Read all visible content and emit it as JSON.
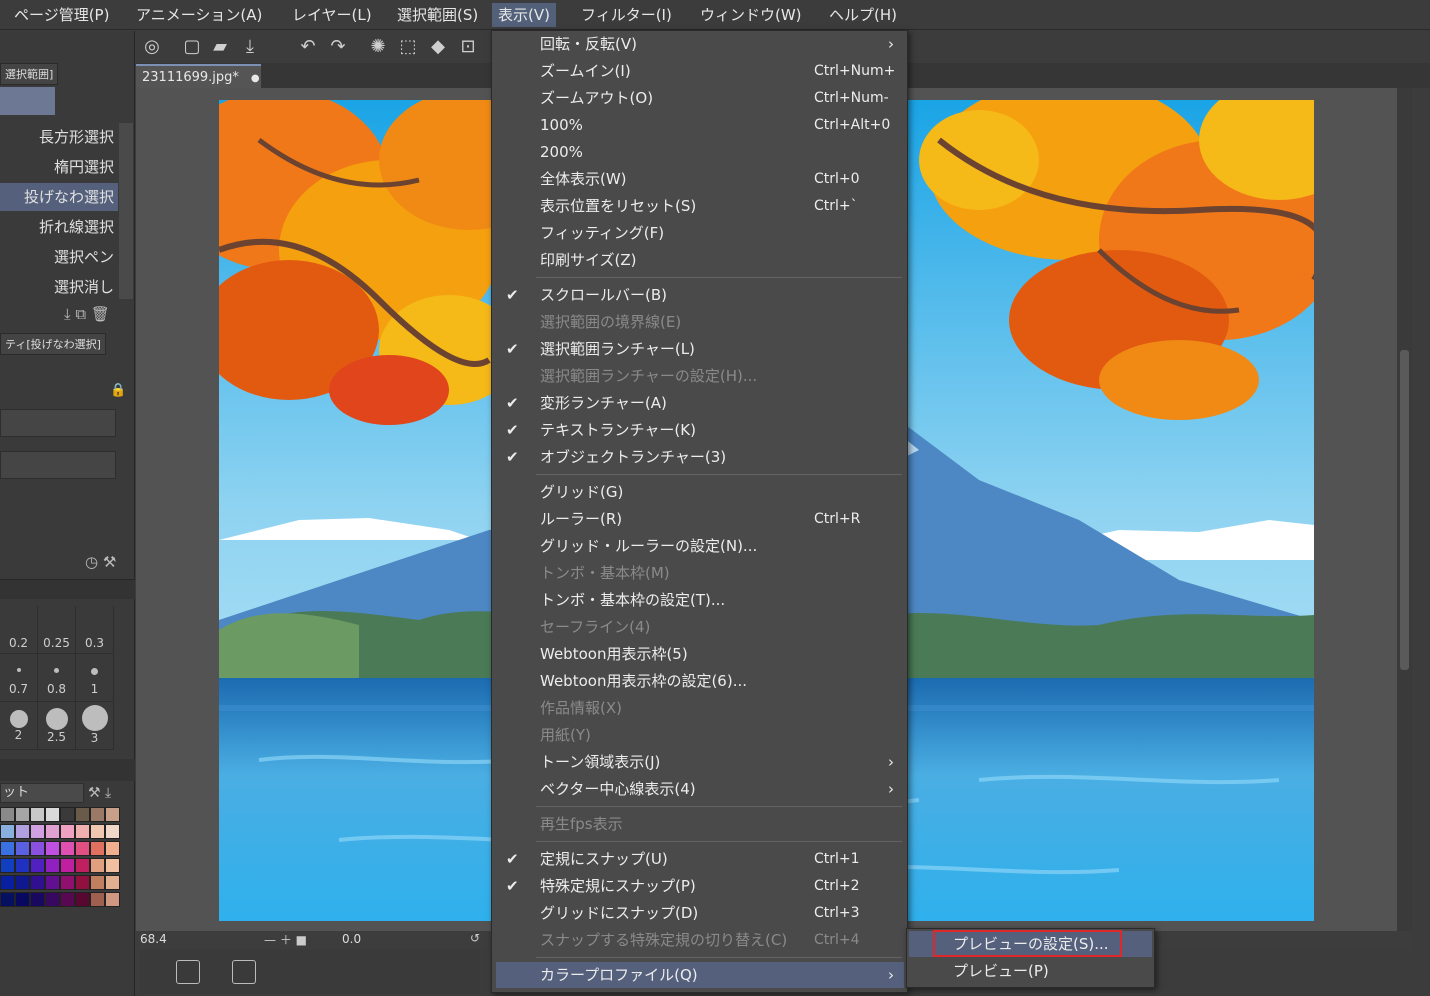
{
  "menubar": {
    "items": [
      "ページ管理(P)",
      "アニメーション(A)",
      "レイヤー(L)",
      "選択範囲(S)",
      "表示(V)",
      "フィルター(I)",
      "ウィンドウ(W)",
      "ヘルプ(H)"
    ]
  },
  "document": {
    "tab_title": "23111699.jpg*"
  },
  "left_panel": {
    "tab_label": "選択範囲]",
    "subtools": [
      "長方形選択",
      "楕円選択",
      "投げなわ選択",
      "折れ線選択",
      "選択ペン",
      "選択消し"
    ],
    "property_title": "ティ[投げなわ選択]",
    "brush_sizes": [
      "0.2",
      "0.25",
      "0.3",
      "0.7",
      "0.8",
      "1",
      "2",
      "2.5",
      "3"
    ],
    "palette_label": "ット"
  },
  "status": {
    "zoom": "68.4",
    "angle": "0.0"
  },
  "view_menu": {
    "items": [
      {
        "label": "回転・反転(V)",
        "shortcut": "",
        "checked": false,
        "disabled": false,
        "submenu": true
      },
      {
        "label": "ズームイン(I)",
        "shortcut": "Ctrl+Num+",
        "checked": false,
        "disabled": false,
        "submenu": false
      },
      {
        "label": "ズームアウト(O)",
        "shortcut": "Ctrl+Num-",
        "checked": false,
        "disabled": false,
        "submenu": false
      },
      {
        "label": "100%",
        "shortcut": "Ctrl+Alt+0",
        "checked": false,
        "disabled": false,
        "submenu": false
      },
      {
        "label": "200%",
        "shortcut": "",
        "checked": false,
        "disabled": false,
        "submenu": false
      },
      {
        "label": "全体表示(W)",
        "shortcut": "Ctrl+0",
        "checked": false,
        "disabled": false,
        "submenu": false
      },
      {
        "label": "表示位置をリセット(S)",
        "shortcut": "Ctrl+`",
        "checked": false,
        "disabled": false,
        "submenu": false
      },
      {
        "label": "フィッティング(F)",
        "shortcut": "",
        "checked": false,
        "disabled": false,
        "submenu": false
      },
      {
        "label": "印刷サイズ(Z)",
        "shortcut": "",
        "checked": false,
        "disabled": false,
        "submenu": false
      },
      {
        "label": "スクロールバー(B)",
        "shortcut": "",
        "checked": true,
        "disabled": false,
        "submenu": false
      },
      {
        "label": "選択範囲の境界線(E)",
        "shortcut": "",
        "checked": false,
        "disabled": true,
        "submenu": false
      },
      {
        "label": "選択範囲ランチャー(L)",
        "shortcut": "",
        "checked": true,
        "disabled": false,
        "submenu": false
      },
      {
        "label": "選択範囲ランチャーの設定(H)...",
        "shortcut": "",
        "checked": false,
        "disabled": true,
        "submenu": false
      },
      {
        "label": "変形ランチャー(A)",
        "shortcut": "",
        "checked": true,
        "disabled": false,
        "submenu": false
      },
      {
        "label": "テキストランチャー(K)",
        "shortcut": "",
        "checked": true,
        "disabled": false,
        "submenu": false
      },
      {
        "label": "オブジェクトランチャー(3)",
        "shortcut": "",
        "checked": true,
        "disabled": false,
        "submenu": false
      },
      {
        "label": "グリッド(G)",
        "shortcut": "",
        "checked": false,
        "disabled": false,
        "submenu": false
      },
      {
        "label": "ルーラー(R)",
        "shortcut": "Ctrl+R",
        "checked": false,
        "disabled": false,
        "submenu": false
      },
      {
        "label": "グリッド・ルーラーの設定(N)...",
        "shortcut": "",
        "checked": false,
        "disabled": false,
        "submenu": false
      },
      {
        "label": "トンボ・基本枠(M)",
        "shortcut": "",
        "checked": false,
        "disabled": true,
        "submenu": false
      },
      {
        "label": "トンボ・基本枠の設定(T)...",
        "shortcut": "",
        "checked": false,
        "disabled": false,
        "submenu": false
      },
      {
        "label": "セーフライン(4)",
        "shortcut": "",
        "checked": false,
        "disabled": true,
        "submenu": false
      },
      {
        "label": "Webtoon用表示枠(5)",
        "shortcut": "",
        "checked": false,
        "disabled": false,
        "submenu": false
      },
      {
        "label": "Webtoon用表示枠の設定(6)...",
        "shortcut": "",
        "checked": false,
        "disabled": false,
        "submenu": false
      },
      {
        "label": "作品情報(X)",
        "shortcut": "",
        "checked": false,
        "disabled": true,
        "submenu": false
      },
      {
        "label": "用紙(Y)",
        "shortcut": "",
        "checked": false,
        "disabled": true,
        "submenu": false
      },
      {
        "label": "トーン領域表示(J)",
        "shortcut": "",
        "checked": false,
        "disabled": false,
        "submenu": true
      },
      {
        "label": "ベクター中心線表示(4)",
        "shortcut": "",
        "checked": false,
        "disabled": false,
        "submenu": true
      },
      {
        "label": "再生fps表示",
        "shortcut": "",
        "checked": false,
        "disabled": true,
        "submenu": false
      },
      {
        "label": "定規にスナップ(U)",
        "shortcut": "Ctrl+1",
        "checked": true,
        "disabled": false,
        "submenu": false
      },
      {
        "label": "特殊定規にスナップ(P)",
        "shortcut": "Ctrl+2",
        "checked": true,
        "disabled": false,
        "submenu": false
      },
      {
        "label": "グリッドにスナップ(D)",
        "shortcut": "Ctrl+3",
        "checked": false,
        "disabled": false,
        "submenu": false
      },
      {
        "label": "スナップする特殊定規の切り替え(C)",
        "shortcut": "Ctrl+4",
        "checked": false,
        "disabled": true,
        "submenu": false
      },
      {
        "label": "カラープロファイル(Q)",
        "shortcut": "",
        "checked": false,
        "disabled": false,
        "submenu": true
      }
    ]
  },
  "color_profile_submenu": {
    "items": [
      "プレビューの設定(S)...",
      "プレビュー(P)"
    ]
  },
  "colors": {
    "accent": "#55617c",
    "highlight_box": "#e0282a"
  }
}
